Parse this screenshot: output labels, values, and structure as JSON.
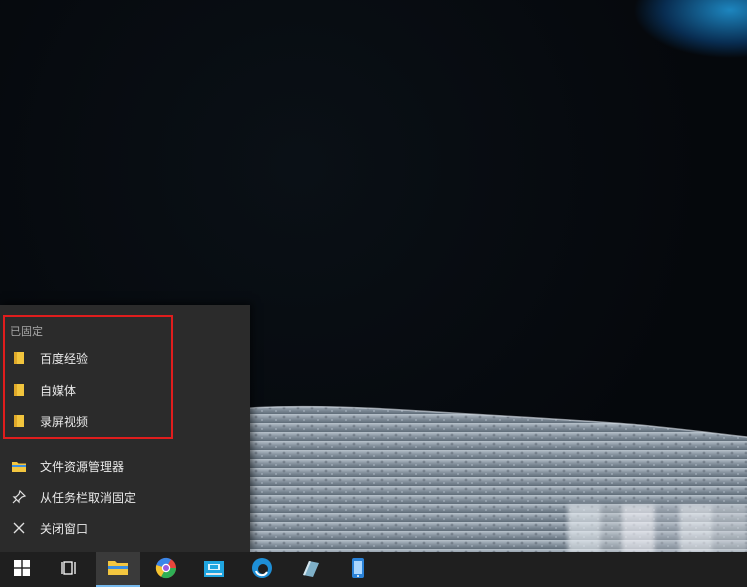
{
  "jumplist": {
    "section_title": "已固定",
    "pinned": [
      {
        "label": "百度经验",
        "icon": "folder-icon"
      },
      {
        "label": "自媒体",
        "icon": "folder-icon"
      },
      {
        "label": "录屏视频",
        "icon": "folder-icon"
      }
    ],
    "tasks": [
      {
        "label": "文件资源管理器",
        "icon": "file-explorer-icon"
      },
      {
        "label": "从任务栏取消固定",
        "icon": "unpin-icon"
      },
      {
        "label": "关闭窗口",
        "icon": "close-icon"
      }
    ],
    "highlight_color": "#e01d1d"
  },
  "taskbar": {
    "accent": "#76b9ed",
    "buttons": [
      {
        "name": "start-button",
        "icon": "windows-logo-icon"
      },
      {
        "name": "task-view-button",
        "icon": "task-view-icon"
      },
      {
        "name": "file-explorer-taskbar-button",
        "icon": "folder-icon",
        "active": true
      },
      {
        "name": "browser-taskbar-button",
        "icon": "chrome-like-icon"
      },
      {
        "name": "store-taskbar-button",
        "icon": "store-icon"
      },
      {
        "name": "edge-taskbar-button",
        "icon": "edge-icon"
      },
      {
        "name": "app-taskbar-button",
        "icon": "notepad-icon"
      },
      {
        "name": "phone-taskbar-button",
        "icon": "phone-icon"
      }
    ]
  }
}
